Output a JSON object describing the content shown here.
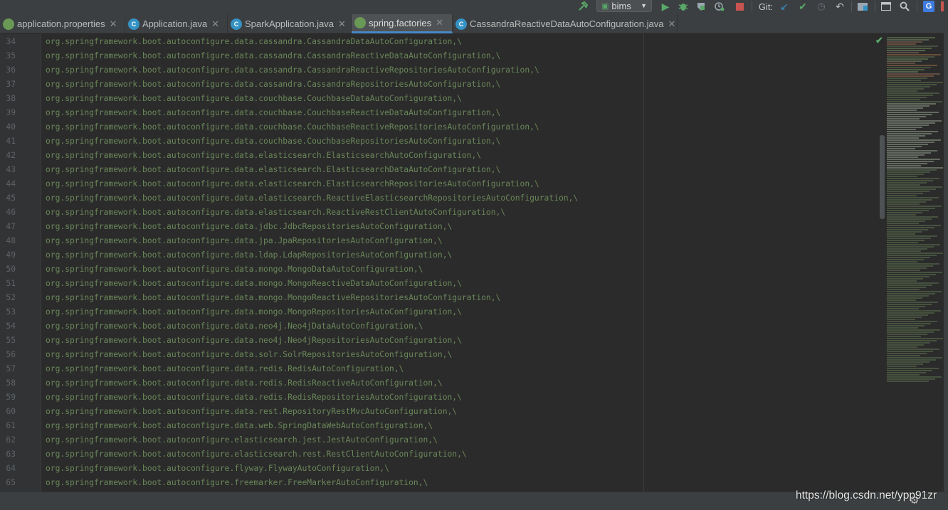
{
  "toolbar": {
    "run_config": "bims",
    "git_label": "Git:"
  },
  "tabs": [
    {
      "label": "application.properties",
      "icon": "spring-leaf-icon",
      "active": false
    },
    {
      "label": "Application.java",
      "icon": "java-class-icon",
      "active": false
    },
    {
      "label": "SparkApplication.java",
      "icon": "java-class-icon",
      "active": false
    },
    {
      "label": "spring.factories",
      "icon": "spring-leaf-icon",
      "active": true
    },
    {
      "label": "CassandraReactiveDataAutoConfiguration.java",
      "icon": "java-class-icon",
      "active": false
    }
  ],
  "editor": {
    "lines": [
      {
        "num": "34",
        "text": "org.springframework.boot.autoconfigure.data.cassandra.CassandraDataAutoConfiguration,\\"
      },
      {
        "num": "35",
        "text": "org.springframework.boot.autoconfigure.data.cassandra.CassandraReactiveDataAutoConfiguration,\\"
      },
      {
        "num": "36",
        "text": "org.springframework.boot.autoconfigure.data.cassandra.CassandraReactiveRepositoriesAutoConfiguration,\\"
      },
      {
        "num": "37",
        "text": "org.springframework.boot.autoconfigure.data.cassandra.CassandraRepositoriesAutoConfiguration,\\"
      },
      {
        "num": "38",
        "text": "org.springframework.boot.autoconfigure.data.couchbase.CouchbaseDataAutoConfiguration,\\"
      },
      {
        "num": "39",
        "text": "org.springframework.boot.autoconfigure.data.couchbase.CouchbaseReactiveDataAutoConfiguration,\\"
      },
      {
        "num": "40",
        "text": "org.springframework.boot.autoconfigure.data.couchbase.CouchbaseReactiveRepositoriesAutoConfiguration,\\"
      },
      {
        "num": "41",
        "text": "org.springframework.boot.autoconfigure.data.couchbase.CouchbaseRepositoriesAutoConfiguration,\\"
      },
      {
        "num": "42",
        "text": "org.springframework.boot.autoconfigure.data.elasticsearch.ElasticsearchAutoConfiguration,\\"
      },
      {
        "num": "43",
        "text": "org.springframework.boot.autoconfigure.data.elasticsearch.ElasticsearchDataAutoConfiguration,\\"
      },
      {
        "num": "44",
        "text": "org.springframework.boot.autoconfigure.data.elasticsearch.ElasticsearchRepositoriesAutoConfiguration,\\"
      },
      {
        "num": "45",
        "text": "org.springframework.boot.autoconfigure.data.elasticsearch.ReactiveElasticsearchRepositoriesAutoConfiguration,\\"
      },
      {
        "num": "46",
        "text": "org.springframework.boot.autoconfigure.data.elasticsearch.ReactiveRestClientAutoConfiguration,\\"
      },
      {
        "num": "47",
        "text": "org.springframework.boot.autoconfigure.data.jdbc.JdbcRepositoriesAutoConfiguration,\\"
      },
      {
        "num": "48",
        "text": "org.springframework.boot.autoconfigure.data.jpa.JpaRepositoriesAutoConfiguration,\\"
      },
      {
        "num": "49",
        "text": "org.springframework.boot.autoconfigure.data.ldap.LdapRepositoriesAutoConfiguration,\\"
      },
      {
        "num": "50",
        "text": "org.springframework.boot.autoconfigure.data.mongo.MongoDataAutoConfiguration,\\"
      },
      {
        "num": "51",
        "text": "org.springframework.boot.autoconfigure.data.mongo.MongoReactiveDataAutoConfiguration,\\"
      },
      {
        "num": "52",
        "text": "org.springframework.boot.autoconfigure.data.mongo.MongoReactiveRepositoriesAutoConfiguration,\\"
      },
      {
        "num": "53",
        "text": "org.springframework.boot.autoconfigure.data.mongo.MongoRepositoriesAutoConfiguration,\\"
      },
      {
        "num": "54",
        "text": "org.springframework.boot.autoconfigure.data.neo4j.Neo4jDataAutoConfiguration,\\"
      },
      {
        "num": "55",
        "text": "org.springframework.boot.autoconfigure.data.neo4j.Neo4jRepositoriesAutoConfiguration,\\"
      },
      {
        "num": "56",
        "text": "org.springframework.boot.autoconfigure.data.solr.SolrRepositoriesAutoConfiguration,\\"
      },
      {
        "num": "57",
        "text": "org.springframework.boot.autoconfigure.data.redis.RedisAutoConfiguration,\\"
      },
      {
        "num": "58",
        "text": "org.springframework.boot.autoconfigure.data.redis.RedisReactiveAutoConfiguration,\\"
      },
      {
        "num": "59",
        "text": "org.springframework.boot.autoconfigure.data.redis.RedisRepositoriesAutoConfiguration,\\"
      },
      {
        "num": "60",
        "text": "org.springframework.boot.autoconfigure.data.rest.RepositoryRestMvcAutoConfiguration,\\"
      },
      {
        "num": "61",
        "text": "org.springframework.boot.autoconfigure.data.web.SpringDataWebAutoConfiguration,\\"
      },
      {
        "num": "62",
        "text": "org.springframework.boot.autoconfigure.elasticsearch.jest.JestAutoConfiguration,\\"
      },
      {
        "num": "63",
        "text": "org.springframework.boot.autoconfigure.elasticsearch.rest.RestClientAutoConfiguration,\\"
      },
      {
        "num": "64",
        "text": "org.springframework.boot.autoconfigure.flyway.FlywayAutoConfiguration,\\"
      },
      {
        "num": "65",
        "text": "org.springframework.boot.autoconfigure.freemarker.FreeMarkerAutoConfiguration,\\"
      }
    ]
  },
  "watermark": "https://blog.csdn.net/ypp91zr",
  "colors": {
    "code_string": "#6a8759",
    "active_tab_underline": "#4a88c7",
    "editor_bg": "#2b2b2b"
  }
}
